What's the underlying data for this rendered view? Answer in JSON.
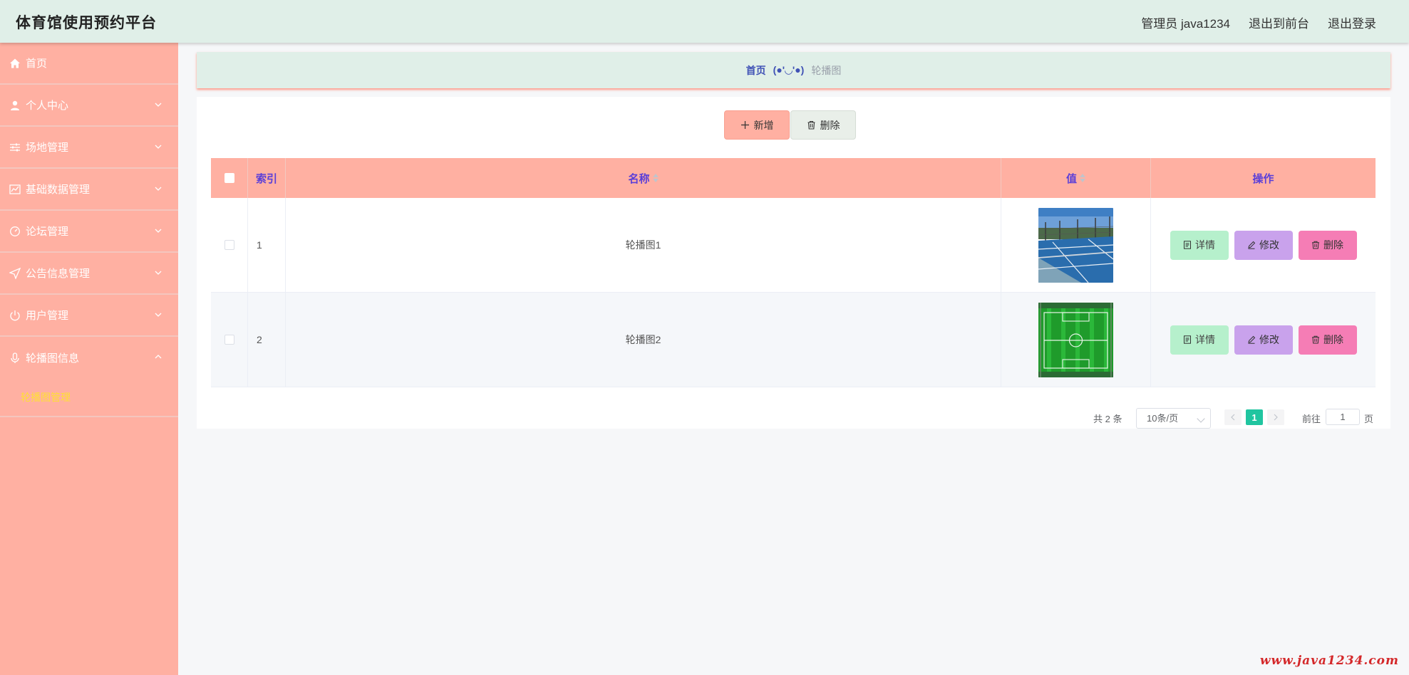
{
  "header": {
    "title": "体育馆使用预约平台",
    "user": "管理员 java1234",
    "to_front": "退出到前台",
    "logout": "退出登录"
  },
  "sidebar": {
    "items": [
      {
        "label": "首页",
        "icon": "home-icon"
      },
      {
        "label": "个人中心",
        "icon": "user-icon"
      },
      {
        "label": "场地管理",
        "icon": "sliders-icon"
      },
      {
        "label": "基础数据管理",
        "icon": "chart-icon"
      },
      {
        "label": "论坛管理",
        "icon": "dashboard-icon"
      },
      {
        "label": "公告信息管理",
        "icon": "send-icon"
      },
      {
        "label": "用户管理",
        "icon": "power-icon"
      },
      {
        "label": "轮播图信息",
        "icon": "microphone-icon"
      }
    ],
    "submenu": {
      "label": "轮播图管理"
    }
  },
  "breadcrumb": {
    "home": "首页",
    "separator": "(●'◡'●)",
    "current": "轮播图"
  },
  "toolbar": {
    "add_label": "新增",
    "delete_label": "删除"
  },
  "table": {
    "headers": {
      "index": "索引",
      "name": "名称",
      "value": "值",
      "actions": "操作"
    },
    "rows": [
      {
        "index": "1",
        "name": "轮播图1",
        "image": "tennis-court"
      },
      {
        "index": "2",
        "name": "轮播图2",
        "image": "football-field"
      }
    ],
    "actions": {
      "detail": "详情",
      "edit": "修改",
      "delete": "删除"
    }
  },
  "pagination": {
    "total_text": "共 2 条",
    "page_size": "10条/页",
    "current_page": "1",
    "goto_label": "前往",
    "goto_value": "1",
    "page_unit": "页"
  },
  "watermark": "www.java1234.com",
  "colors": {
    "header_bg": "#e0efe8",
    "sidebar_bg": "#ffb0a2",
    "table_header_bg": "#ffb0a2",
    "header_text": "#5b3fd8",
    "detail_btn": "#b6f0cc",
    "edit_btn": "#c9a2ec",
    "delete_btn": "#f57db5",
    "pager_active": "#20c5a0",
    "submenu_active": "#ffe033"
  }
}
